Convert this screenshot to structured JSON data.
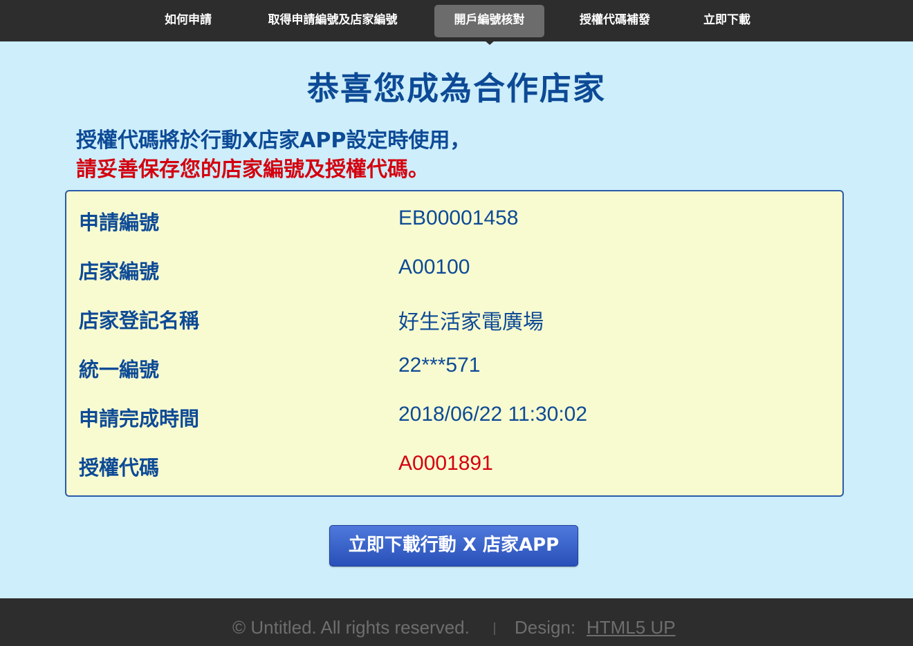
{
  "nav": {
    "items": [
      {
        "label": "如何申請",
        "active": false
      },
      {
        "label": "取得申請編號及店家編號",
        "active": false
      },
      {
        "label": "開戶編號核對",
        "active": true
      },
      {
        "label": "授權代碼補發",
        "active": false
      },
      {
        "label": "立即下載",
        "active": false
      }
    ]
  },
  "headline": "恭喜您成為合作店家",
  "intro": {
    "line1": "授權代碼將於行動X店家APP設定時使用，",
    "line2": "請妥善保存您的店家編號及授權代碼。"
  },
  "info": [
    {
      "label": "申請編號",
      "value": "EB00001458"
    },
    {
      "label": "店家編號",
      "value": "A00100"
    },
    {
      "label": "店家登記名稱",
      "value": "好生活家電廣場"
    },
    {
      "label": "統一編號",
      "value": "22***571"
    },
    {
      "label": "申請完成時間",
      "value": "2018/06/22 11:30:02"
    },
    {
      "label": "授權代碼",
      "value": "A0001891",
      "highlight": "#d4000f"
    }
  ],
  "download_button": "立即下載行動 X 店家APP",
  "footer": {
    "copyright": "© Untitled. All rights reserved.",
    "design_label": "Design:",
    "design_link": "HTML5 UP"
  },
  "colors": {
    "page_background": "#cdeefa",
    "nav_background": "#2d2d2d",
    "nav_active": "#6c6c6c",
    "heading_blue": "#0d4a96",
    "warning_red": "#d4000f",
    "panel_background": "#f8fbd0",
    "panel_border": "#2b5aa8",
    "button_blue": "#3b64c8"
  }
}
